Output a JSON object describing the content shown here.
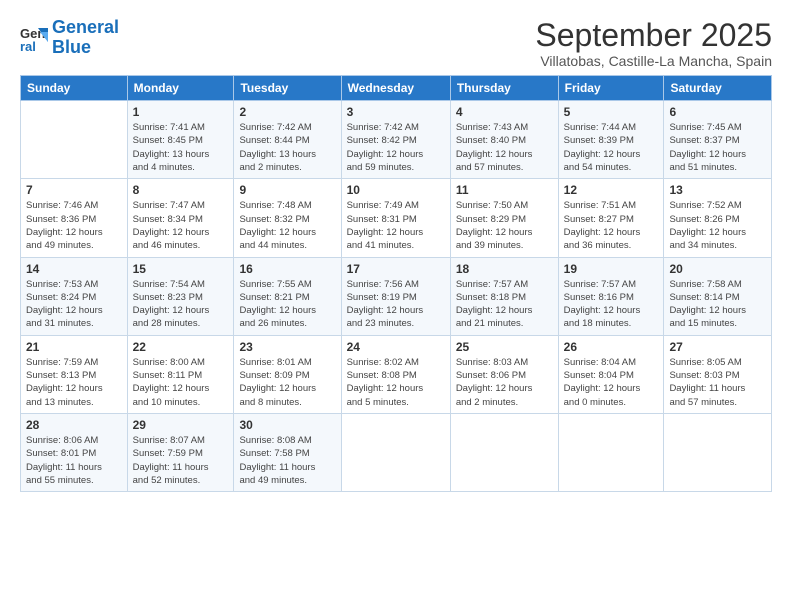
{
  "logo": {
    "line1": "General",
    "line2": "Blue"
  },
  "title": "September 2025",
  "subtitle": "Villatobas, Castille-La Mancha, Spain",
  "headers": [
    "Sunday",
    "Monday",
    "Tuesday",
    "Wednesday",
    "Thursday",
    "Friday",
    "Saturday"
  ],
  "weeks": [
    [
      {
        "num": "",
        "info": ""
      },
      {
        "num": "1",
        "info": "Sunrise: 7:41 AM\nSunset: 8:45 PM\nDaylight: 13 hours\nand 4 minutes."
      },
      {
        "num": "2",
        "info": "Sunrise: 7:42 AM\nSunset: 8:44 PM\nDaylight: 13 hours\nand 2 minutes."
      },
      {
        "num": "3",
        "info": "Sunrise: 7:42 AM\nSunset: 8:42 PM\nDaylight: 12 hours\nand 59 minutes."
      },
      {
        "num": "4",
        "info": "Sunrise: 7:43 AM\nSunset: 8:40 PM\nDaylight: 12 hours\nand 57 minutes."
      },
      {
        "num": "5",
        "info": "Sunrise: 7:44 AM\nSunset: 8:39 PM\nDaylight: 12 hours\nand 54 minutes."
      },
      {
        "num": "6",
        "info": "Sunrise: 7:45 AM\nSunset: 8:37 PM\nDaylight: 12 hours\nand 51 minutes."
      }
    ],
    [
      {
        "num": "7",
        "info": "Sunrise: 7:46 AM\nSunset: 8:36 PM\nDaylight: 12 hours\nand 49 minutes."
      },
      {
        "num": "8",
        "info": "Sunrise: 7:47 AM\nSunset: 8:34 PM\nDaylight: 12 hours\nand 46 minutes."
      },
      {
        "num": "9",
        "info": "Sunrise: 7:48 AM\nSunset: 8:32 PM\nDaylight: 12 hours\nand 44 minutes."
      },
      {
        "num": "10",
        "info": "Sunrise: 7:49 AM\nSunset: 8:31 PM\nDaylight: 12 hours\nand 41 minutes."
      },
      {
        "num": "11",
        "info": "Sunrise: 7:50 AM\nSunset: 8:29 PM\nDaylight: 12 hours\nand 39 minutes."
      },
      {
        "num": "12",
        "info": "Sunrise: 7:51 AM\nSunset: 8:27 PM\nDaylight: 12 hours\nand 36 minutes."
      },
      {
        "num": "13",
        "info": "Sunrise: 7:52 AM\nSunset: 8:26 PM\nDaylight: 12 hours\nand 34 minutes."
      }
    ],
    [
      {
        "num": "14",
        "info": "Sunrise: 7:53 AM\nSunset: 8:24 PM\nDaylight: 12 hours\nand 31 minutes."
      },
      {
        "num": "15",
        "info": "Sunrise: 7:54 AM\nSunset: 8:23 PM\nDaylight: 12 hours\nand 28 minutes."
      },
      {
        "num": "16",
        "info": "Sunrise: 7:55 AM\nSunset: 8:21 PM\nDaylight: 12 hours\nand 26 minutes."
      },
      {
        "num": "17",
        "info": "Sunrise: 7:56 AM\nSunset: 8:19 PM\nDaylight: 12 hours\nand 23 minutes."
      },
      {
        "num": "18",
        "info": "Sunrise: 7:57 AM\nSunset: 8:18 PM\nDaylight: 12 hours\nand 21 minutes."
      },
      {
        "num": "19",
        "info": "Sunrise: 7:57 AM\nSunset: 8:16 PM\nDaylight: 12 hours\nand 18 minutes."
      },
      {
        "num": "20",
        "info": "Sunrise: 7:58 AM\nSunset: 8:14 PM\nDaylight: 12 hours\nand 15 minutes."
      }
    ],
    [
      {
        "num": "21",
        "info": "Sunrise: 7:59 AM\nSunset: 8:13 PM\nDaylight: 12 hours\nand 13 minutes."
      },
      {
        "num": "22",
        "info": "Sunrise: 8:00 AM\nSunset: 8:11 PM\nDaylight: 12 hours\nand 10 minutes."
      },
      {
        "num": "23",
        "info": "Sunrise: 8:01 AM\nSunset: 8:09 PM\nDaylight: 12 hours\nand 8 minutes."
      },
      {
        "num": "24",
        "info": "Sunrise: 8:02 AM\nSunset: 8:08 PM\nDaylight: 12 hours\nand 5 minutes."
      },
      {
        "num": "25",
        "info": "Sunrise: 8:03 AM\nSunset: 8:06 PM\nDaylight: 12 hours\nand 2 minutes."
      },
      {
        "num": "26",
        "info": "Sunrise: 8:04 AM\nSunset: 8:04 PM\nDaylight: 12 hours\nand 0 minutes."
      },
      {
        "num": "27",
        "info": "Sunrise: 8:05 AM\nSunset: 8:03 PM\nDaylight: 11 hours\nand 57 minutes."
      }
    ],
    [
      {
        "num": "28",
        "info": "Sunrise: 8:06 AM\nSunset: 8:01 PM\nDaylight: 11 hours\nand 55 minutes."
      },
      {
        "num": "29",
        "info": "Sunrise: 8:07 AM\nSunset: 7:59 PM\nDaylight: 11 hours\nand 52 minutes."
      },
      {
        "num": "30",
        "info": "Sunrise: 8:08 AM\nSunset: 7:58 PM\nDaylight: 11 hours\nand 49 minutes."
      },
      {
        "num": "",
        "info": ""
      },
      {
        "num": "",
        "info": ""
      },
      {
        "num": "",
        "info": ""
      },
      {
        "num": "",
        "info": ""
      }
    ]
  ]
}
